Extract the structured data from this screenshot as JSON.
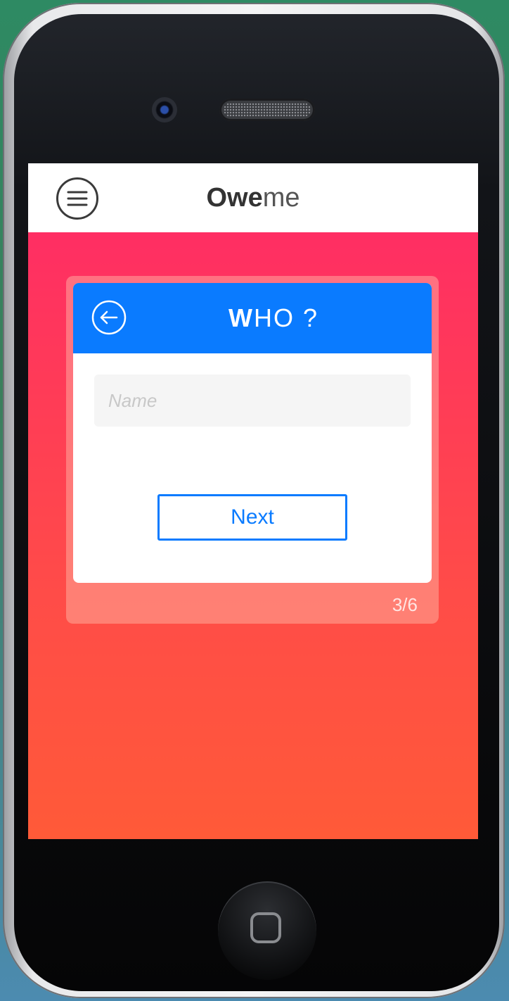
{
  "header": {
    "title_bold": "Owe",
    "title_light": "me"
  },
  "card": {
    "title_bold": "W",
    "title_rest": "HO ?",
    "name_placeholder": "Name",
    "next_label": "Next",
    "step": "3/6"
  },
  "colors": {
    "accent": "#0a7bff",
    "gradient_top": "#ff2e63",
    "gradient_bottom": "#ff5a38",
    "header_bg": "#ffffff"
  },
  "icons": {
    "menu": "hamburger-menu-icon",
    "back": "arrow-left-circle-icon",
    "home": "home-button-icon"
  }
}
